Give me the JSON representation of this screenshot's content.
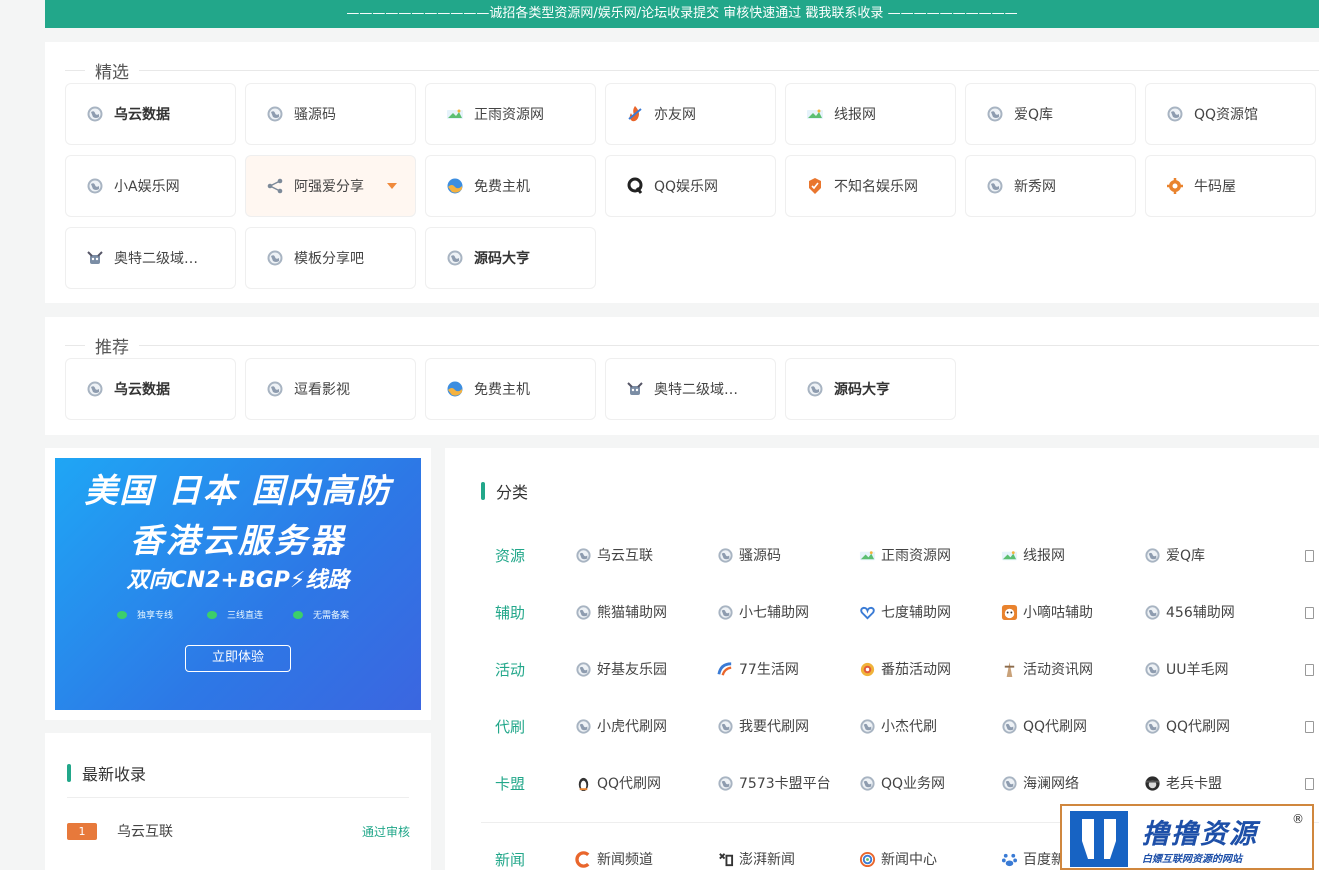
{
  "banner": "———————————诚招各类型资源网/娱乐网/论坛收录提交 审核快速通过 戳我联系收录 ——————————",
  "featured": {
    "title": "精选",
    "items": [
      {
        "label": "乌云数据",
        "icon": "globe",
        "bold": true
      },
      {
        "label": "骚源码",
        "icon": "globe"
      },
      {
        "label": "正雨资源网",
        "icon": "landscape"
      },
      {
        "label": "亦友网",
        "icon": "flame"
      },
      {
        "label": "线报网",
        "icon": "landscape"
      },
      {
        "label": "爱Q库",
        "icon": "globe"
      },
      {
        "label": "QQ资源馆",
        "icon": "globe"
      },
      {
        "label": "小A娱乐网",
        "icon": "globe"
      },
      {
        "label": "阿强爱分享",
        "icon": "share",
        "active": true
      },
      {
        "label": "免费主机",
        "icon": "wave"
      },
      {
        "label": "QQ娱乐网",
        "icon": "letter-q"
      },
      {
        "label": "不知名娱乐网",
        "icon": "badge"
      },
      {
        "label": "新秀网",
        "icon": "globe"
      },
      {
        "label": "牛码屋",
        "icon": "gear"
      },
      {
        "label": "奥特二级域…",
        "icon": "robot"
      },
      {
        "label": "模板分享吧",
        "icon": "globe"
      },
      {
        "label": "源码大亨",
        "icon": "globe",
        "bold": true
      }
    ]
  },
  "recommended": {
    "title": "推荐",
    "items": [
      {
        "label": "乌云数据",
        "icon": "globe",
        "bold": true
      },
      {
        "label": "逗看影视",
        "icon": "globe"
      },
      {
        "label": "免费主机",
        "icon": "wave"
      },
      {
        "label": "奥特二级域…",
        "icon": "robot"
      },
      {
        "label": "源码大亨",
        "icon": "globe",
        "bold": true
      }
    ]
  },
  "ad": {
    "line1": "美国 日本 国内高防",
    "line2": "香港云服务器",
    "line3": "双向CN2+BGP⚡线路",
    "features": [
      "独享专线",
      "三线直连",
      "无需备案"
    ],
    "button": "立即体验"
  },
  "latest": {
    "title": "最新收录",
    "items": [
      {
        "rank": "1",
        "name": "乌云互联",
        "status": "通过审核"
      }
    ]
  },
  "categories": {
    "title": "分类",
    "rows": [
      {
        "label": "资源",
        "items": [
          {
            "name": "乌云互联",
            "icon": "globe"
          },
          {
            "name": "骚源码",
            "icon": "globe"
          },
          {
            "name": "正雨资源网",
            "icon": "landscape"
          },
          {
            "name": "线报网",
            "icon": "landscape"
          },
          {
            "name": "爱Q库",
            "icon": "globe"
          }
        ]
      },
      {
        "label": "辅助",
        "items": [
          {
            "name": "熊猫辅助网",
            "icon": "globe"
          },
          {
            "name": "小七辅助网",
            "icon": "globe"
          },
          {
            "name": "七度辅助网",
            "icon": "heart"
          },
          {
            "name": "小嘀咕辅助",
            "icon": "face"
          },
          {
            "name": "456辅助网",
            "icon": "globe"
          }
        ]
      },
      {
        "label": "活动",
        "items": [
          {
            "name": "好基友乐园",
            "icon": "globe"
          },
          {
            "name": "77生活网",
            "icon": "arc"
          },
          {
            "name": "番茄活动网",
            "icon": "chip"
          },
          {
            "name": "活动资讯网",
            "icon": "tower"
          },
          {
            "name": "UU羊毛网",
            "icon": "globe"
          }
        ]
      },
      {
        "label": "代刷",
        "items": [
          {
            "name": "小虎代刷网",
            "icon": "globe"
          },
          {
            "name": "我要代刷网",
            "icon": "globe"
          },
          {
            "name": "小杰代刷",
            "icon": "globe"
          },
          {
            "name": "QQ代刷网",
            "icon": "globe"
          },
          {
            "name": "QQ代刷网",
            "icon": "globe"
          }
        ]
      },
      {
        "label": "卡盟",
        "items": [
          {
            "name": "QQ代刷网",
            "icon": "penguin"
          },
          {
            "name": "7573卡盟平台",
            "icon": "globe"
          },
          {
            "name": "QQ业务网",
            "icon": "globe"
          },
          {
            "name": "海澜网络",
            "icon": "globe"
          },
          {
            "name": "老兵卡盟",
            "icon": "soldier"
          }
        ]
      },
      {
        "label": "新闻",
        "items": [
          {
            "name": "新闻频道",
            "icon": "c-logo"
          },
          {
            "name": "澎湃新闻",
            "icon": "pengpai"
          },
          {
            "name": "新闻中心",
            "icon": "cctv"
          },
          {
            "name": "百度新闻",
            "icon": "paw"
          }
        ]
      }
    ]
  },
  "watermark": {
    "title": "撸撸资源",
    "subtitle": "白嫖互联网资源的网站",
    "reg": "®"
  },
  "colors": {
    "accent": "#22a78a",
    "orange": "#e7793b"
  }
}
